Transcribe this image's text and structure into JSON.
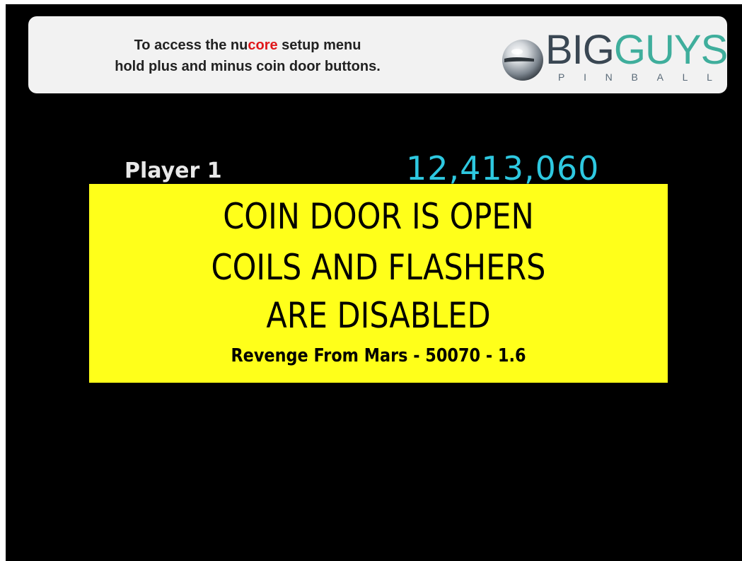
{
  "banner": {
    "line1_prefix": "To access the nu",
    "line1_core": "core",
    "line1_suffix": " setup menu",
    "line2": "hold plus and minus coin door buttons."
  },
  "logo": {
    "word_big": "BIG",
    "word_guys": "GUYS",
    "subtitle_letters": [
      "P",
      "I",
      "N",
      "B",
      "A",
      "L",
      "L"
    ],
    "icon": "pinball-icon",
    "colors": {
      "big": "#3a4753",
      "guys": "#3fae9c",
      "core_highlight": "#e0181b"
    }
  },
  "scoreboard": {
    "player_label": "Player 1",
    "score": "12,413,060",
    "score_color": "#2ec8e0"
  },
  "alert": {
    "line1": "COIN DOOR IS OPEN",
    "line2": "COILS AND FLASHERS",
    "line3": "ARE DISABLED",
    "subline": "Revenge From Mars - 50070 - 1.6",
    "background": "#ffff1a"
  }
}
